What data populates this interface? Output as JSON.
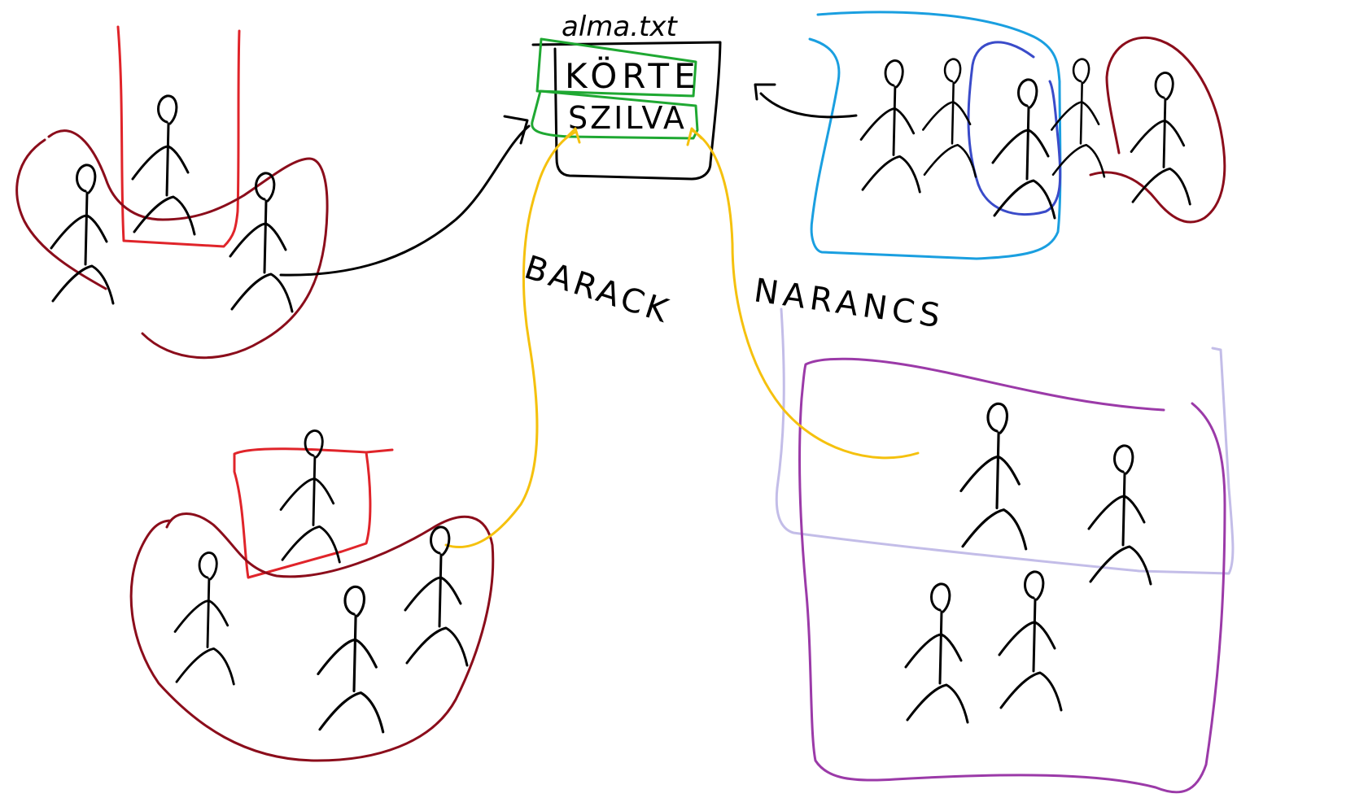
{
  "file": {
    "title": "alma.txt",
    "entries": [
      "KÖRTE",
      "SZILVA"
    ]
  },
  "labels": {
    "barack": "BARACK",
    "narancs": "NARANCS"
  },
  "colors": {
    "ink": "#000000",
    "red": "#e0242a",
    "dark_red": "#8b0d1b",
    "green": "#1fa832",
    "yellow": "#f5c10e",
    "light_blue": "#1a9fe0",
    "blue": "#3a4bc9",
    "purple": "#9b3aa8",
    "lavender": "#c3bde8"
  },
  "icons": [
    "stick-figure-icon",
    "arrow-icon"
  ]
}
